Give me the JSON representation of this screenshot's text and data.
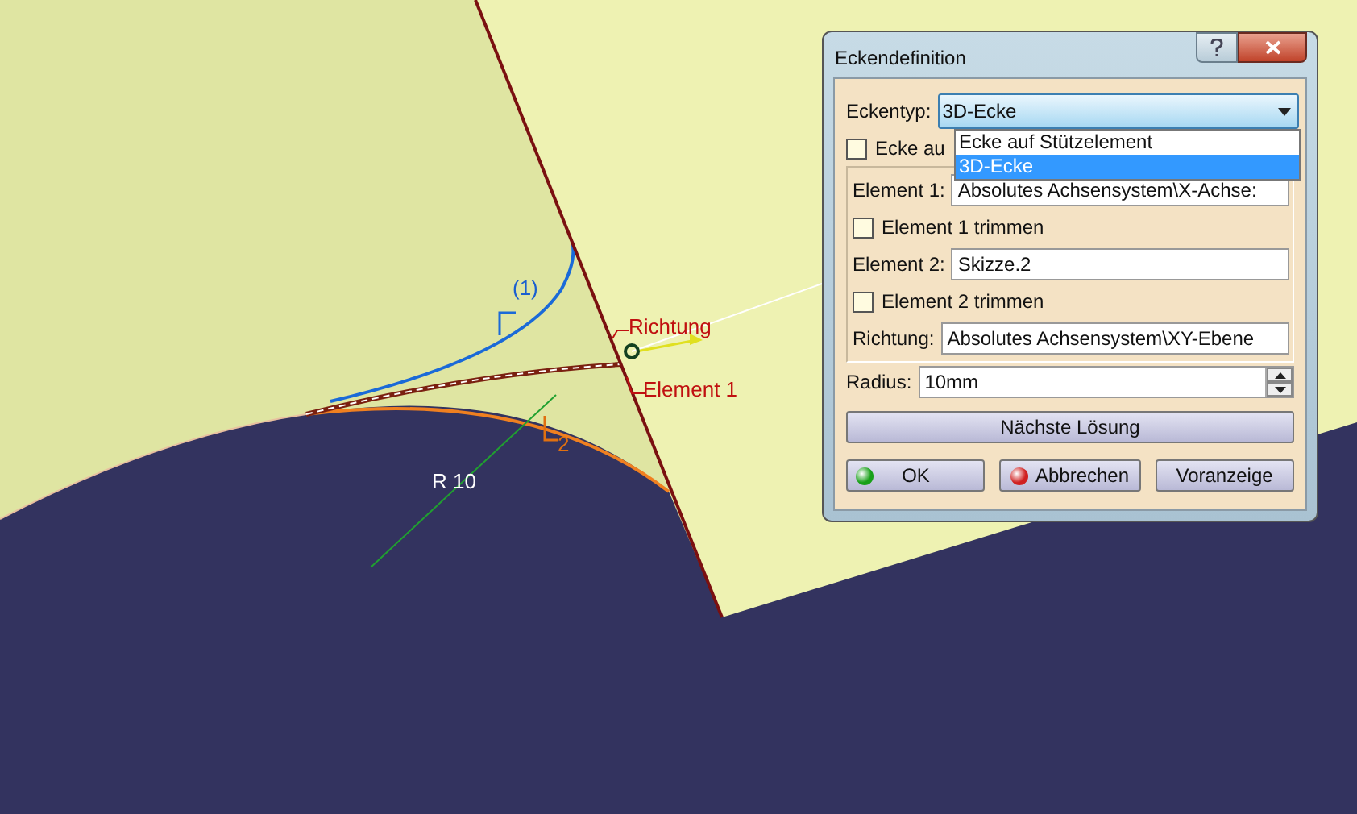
{
  "viewport": {
    "labels": [
      {
        "text": "(1)",
        "kind": "blue"
      },
      {
        "text": "2",
        "kind": "orange"
      },
      {
        "text": "Richtung",
        "kind": "red"
      },
      {
        "text": "Element 1",
        "kind": "red"
      },
      {
        "text": "R 10",
        "kind": "white"
      }
    ]
  },
  "dialog": {
    "title": "Eckendefinition",
    "corner_type": {
      "label": "Eckentyp:",
      "value": "3D-Ecke",
      "expanded": true,
      "options": [
        {
          "label": "Ecke auf Stützelement",
          "selected": false
        },
        {
          "label": "3D-Ecke",
          "selected": true
        }
      ]
    },
    "support_checkbox": {
      "label": "Ecke au",
      "checked": false
    },
    "element_1": {
      "label": "Element 1:",
      "value": "Absolutes Achsensystem\\X-Achse:"
    },
    "trim_1": {
      "label": "Element 1 trimmen",
      "checked": false
    },
    "element_2": {
      "label": "Element 2:",
      "value": "Skizze.2"
    },
    "trim_2": {
      "label": "Element 2 trimmen",
      "checked": false
    },
    "direction": {
      "label": "Richtung:",
      "value": "Absolutes Achsensystem\\XY-Ebene"
    },
    "radius": {
      "label": "Radius:",
      "value": "10mm"
    },
    "next_button": "Nächste Lösung",
    "buttons": [
      {
        "label": "OK",
        "kind": "ok"
      },
      {
        "label": "Abbrechen",
        "kind": "cancel"
      },
      {
        "label": "Voranzeige",
        "kind": "plain"
      }
    ]
  }
}
